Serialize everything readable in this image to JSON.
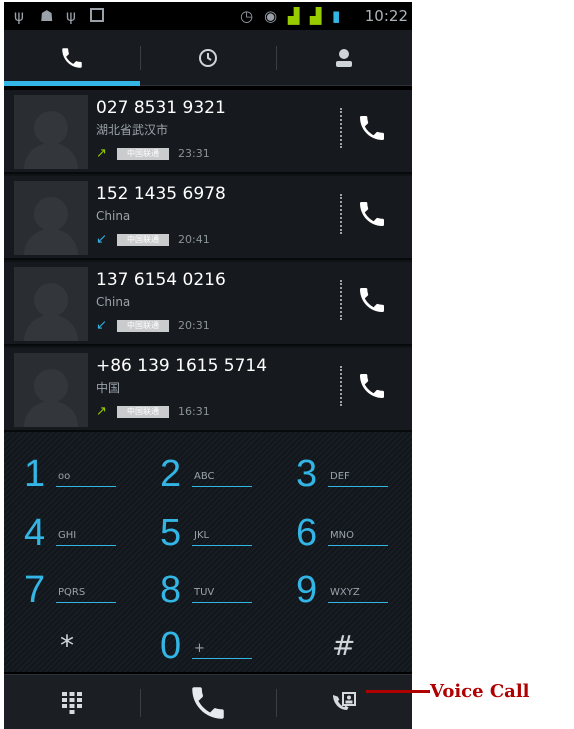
{
  "status_bar": {
    "time": "10:22",
    "icons": [
      "usb-icon",
      "debug-icon",
      "usb-icon",
      "photo-icon",
      "alarm-icon",
      "sync-icon",
      "signal-icon",
      "signal-icon",
      "battery-icon"
    ]
  },
  "tabs": [
    {
      "name": "phone",
      "icon": "phone-icon",
      "selected": true
    },
    {
      "name": "call-log",
      "icon": "clock-icon",
      "selected": false
    },
    {
      "name": "contacts",
      "icon": "person-icon",
      "selected": false
    }
  ],
  "calls": [
    {
      "number": "027 8531 9321",
      "location": "湖北省武汉市",
      "direction": "outgoing",
      "carrier": "中国联通",
      "time": "23:31"
    },
    {
      "number": "152 1435 6978",
      "location": "China",
      "direction": "incoming",
      "carrier": "中国联通",
      "time": "20:41"
    },
    {
      "number": "137 6154 0216",
      "location": "China",
      "direction": "incoming",
      "carrier": "中国联通",
      "time": "20:31"
    },
    {
      "number": "+86 139 1615 5714",
      "location": "中国",
      "direction": "outgoing",
      "carrier": "中国联通",
      "time": "16:31"
    }
  ],
  "dialpad": [
    {
      "digit": "1",
      "letters": "oo"
    },
    {
      "digit": "2",
      "letters": "ABC"
    },
    {
      "digit": "3",
      "letters": "DEF"
    },
    {
      "digit": "4",
      "letters": "GHI"
    },
    {
      "digit": "5",
      "letters": "JKL"
    },
    {
      "digit": "6",
      "letters": "MNO"
    },
    {
      "digit": "7",
      "letters": "PQRS"
    },
    {
      "digit": "8",
      "letters": "TUV"
    },
    {
      "digit": "9",
      "letters": "WXYZ"
    },
    {
      "digit": "*",
      "letters": ""
    },
    {
      "digit": "0",
      "letters": "+"
    },
    {
      "digit": "#",
      "letters": ""
    }
  ],
  "bottom_bar": [
    "dialpad-grid-icon",
    "call-icon",
    "voice-call-icon"
  ],
  "annotation": {
    "label": "Voice Call"
  },
  "colors": {
    "accent": "#33b5e5",
    "outgoing": "#99cc00",
    "background": "#101316",
    "annotation": "#b00000"
  }
}
